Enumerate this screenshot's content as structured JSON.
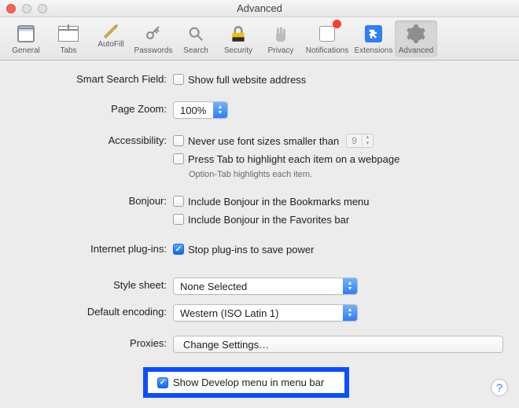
{
  "window": {
    "title": "Advanced"
  },
  "toolbar": {
    "items": [
      {
        "label": "General"
      },
      {
        "label": "Tabs"
      },
      {
        "label": "AutoFill"
      },
      {
        "label": "Passwords"
      },
      {
        "label": "Search"
      },
      {
        "label": "Security"
      },
      {
        "label": "Privacy"
      },
      {
        "label": "Notifications"
      },
      {
        "label": "Extensions"
      },
      {
        "label": "Advanced"
      }
    ]
  },
  "form": {
    "smartSearch": {
      "label": "Smart Search Field:",
      "showFullAddress": "Show full website address"
    },
    "pageZoom": {
      "label": "Page Zoom:",
      "value": "100%"
    },
    "accessibility": {
      "label": "Accessibility:",
      "neverSmaller": "Never use font sizes smaller than",
      "minSize": "9",
      "pressTab": "Press Tab to highlight each item on a webpage",
      "hint": "Option-Tab highlights each item."
    },
    "bonjour": {
      "label": "Bonjour:",
      "bookmarks": "Include Bonjour in the Bookmarks menu",
      "favorites": "Include Bonjour in the Favorites bar"
    },
    "plugins": {
      "label": "Internet plug-ins:",
      "stop": "Stop plug-ins to save power"
    },
    "stylesheet": {
      "label": "Style sheet:",
      "value": "None Selected"
    },
    "encoding": {
      "label": "Default encoding:",
      "value": "Western (ISO Latin 1)"
    },
    "proxies": {
      "label": "Proxies:",
      "button": "Change Settings…"
    },
    "develop": {
      "label": "Show Develop menu in menu bar"
    }
  },
  "help": {
    "symbol": "?"
  }
}
